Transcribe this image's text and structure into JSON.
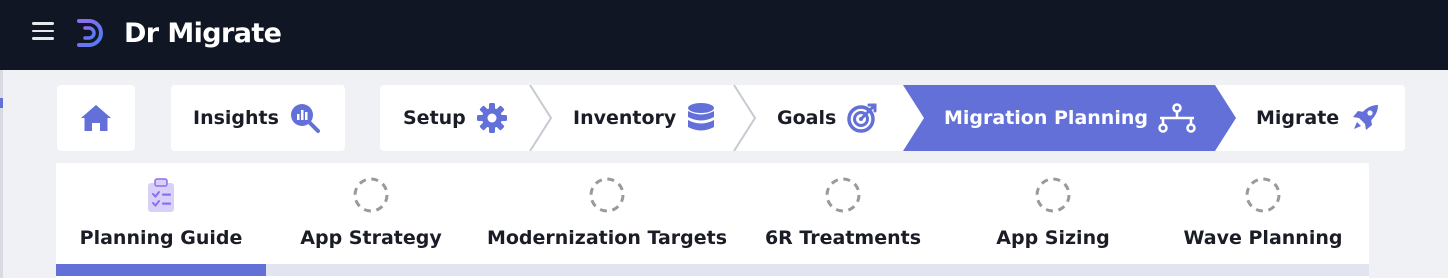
{
  "app": {
    "name": "Dr Migrate"
  },
  "steps": [
    {
      "label": "Insights",
      "icon": "analytics-search-icon"
    },
    {
      "label": "Setup",
      "icon": "gear-icon"
    },
    {
      "label": "Inventory",
      "icon": "database-icon"
    },
    {
      "label": "Goals",
      "icon": "target-icon"
    },
    {
      "label": "Migration Planning",
      "icon": "sitemap-icon",
      "active": true
    },
    {
      "label": "Migrate",
      "icon": "rocket-icon"
    }
  ],
  "tabs": [
    {
      "label": "Planning Guide",
      "icon": "clipboard-checklist-icon",
      "selected": true
    },
    {
      "label": "App Strategy",
      "icon": "pending-circle-icon"
    },
    {
      "label": "Modernization Targets",
      "icon": "pending-circle-icon"
    },
    {
      "label": "6R Treatments",
      "icon": "pending-circle-icon"
    },
    {
      "label": "App Sizing",
      "icon": "pending-circle-icon"
    },
    {
      "label": "Wave Planning",
      "icon": "pending-circle-icon"
    }
  ],
  "colors": {
    "accent": "#6270d8",
    "topbar": "#101623",
    "background": "#eff1f5"
  }
}
